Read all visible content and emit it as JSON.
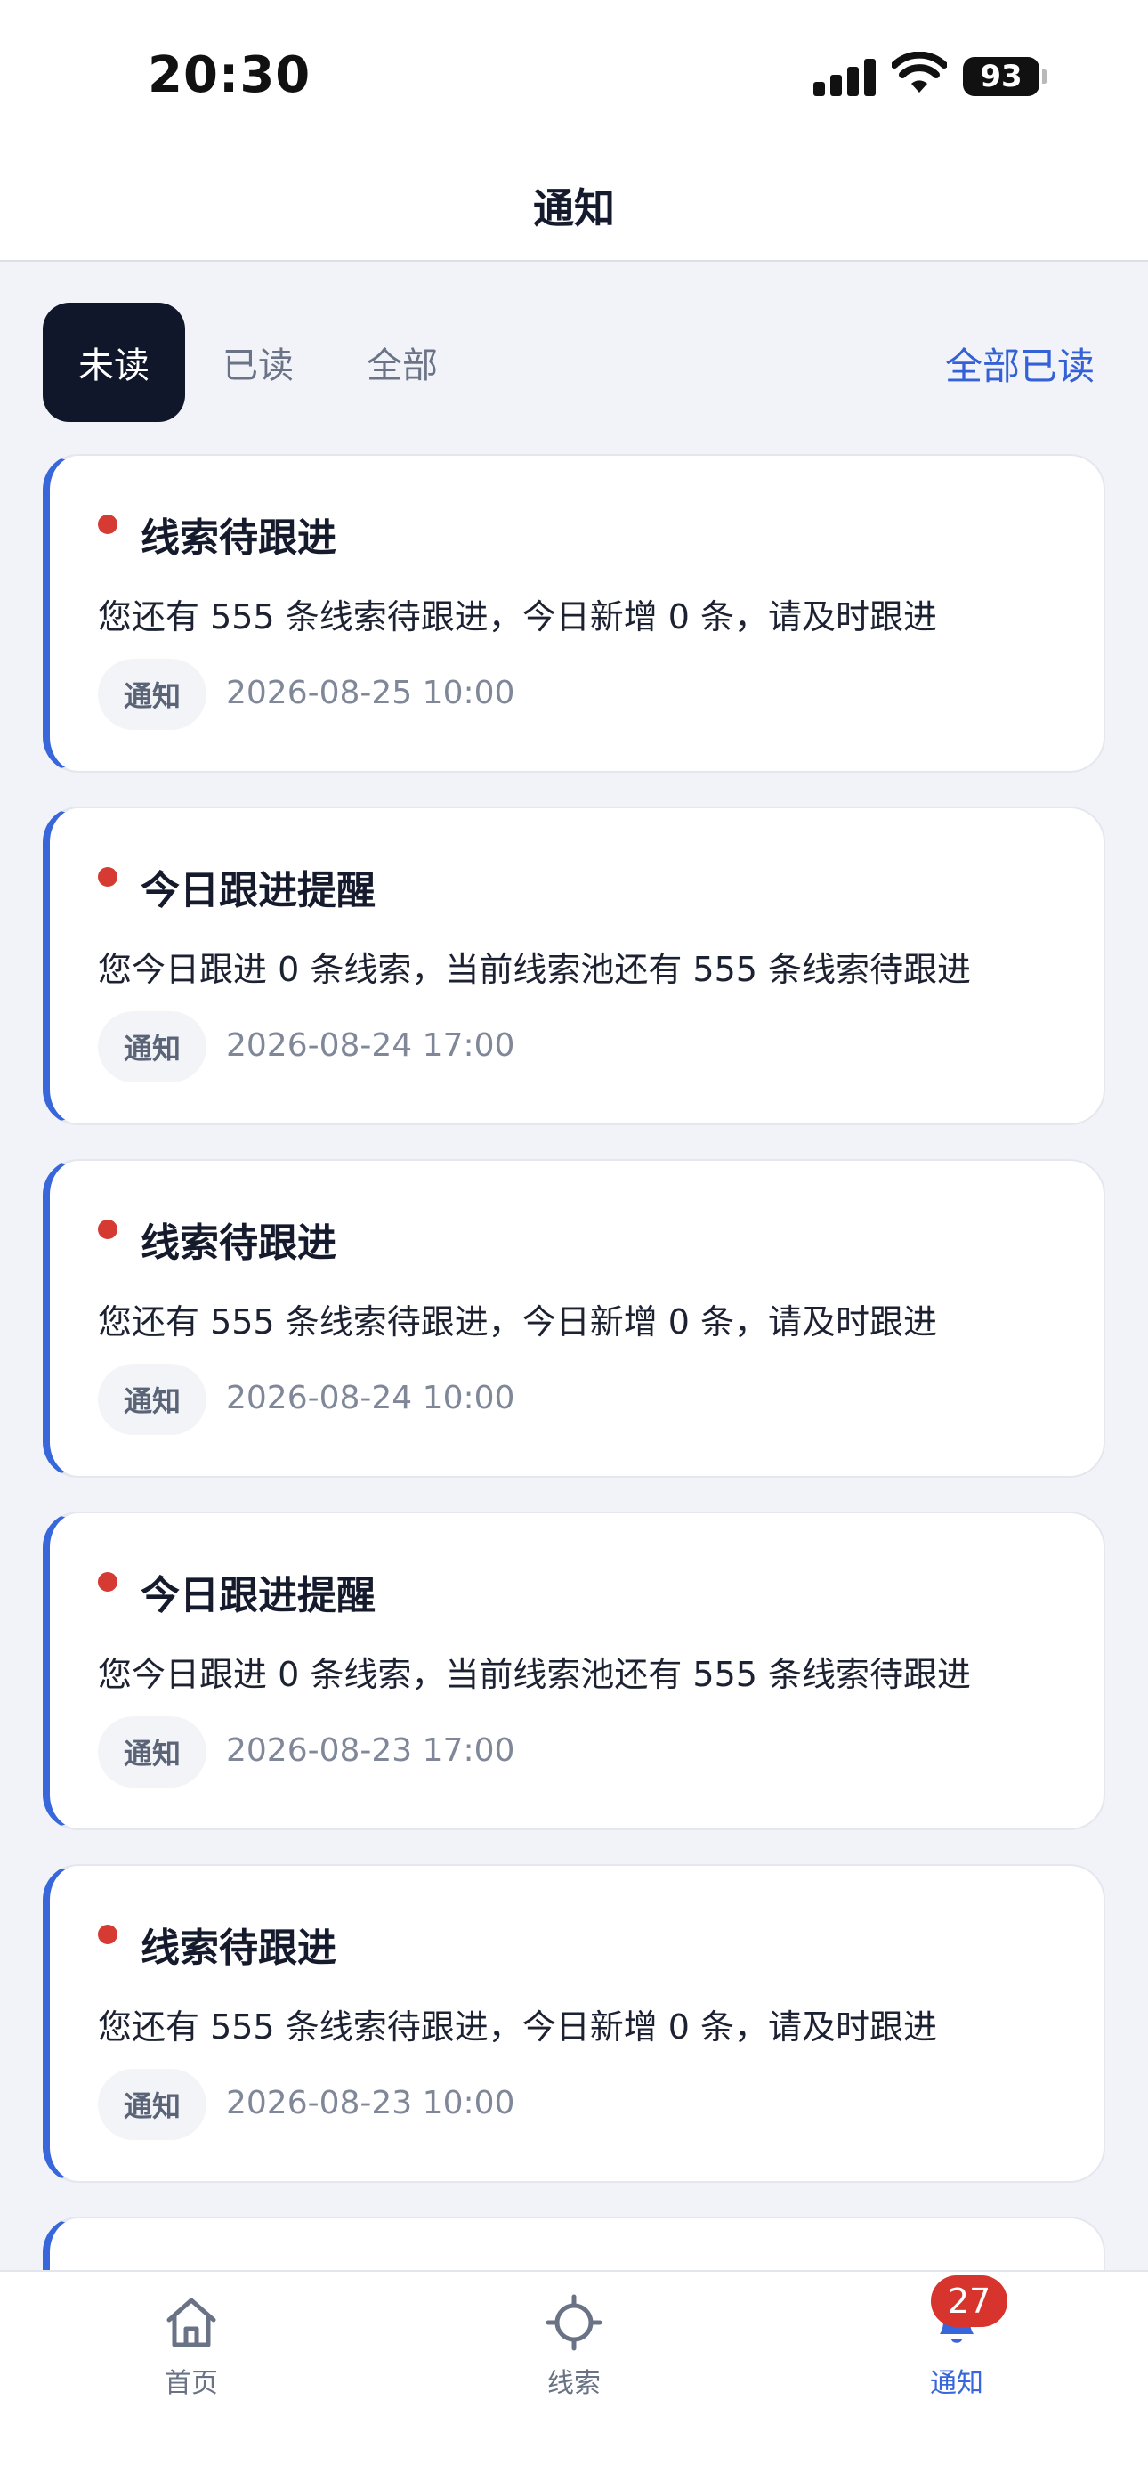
{
  "status_bar": {
    "time": "20:30",
    "battery": "93"
  },
  "header": {
    "title": "通知"
  },
  "tabs": [
    {
      "label": "未读",
      "active": true
    },
    {
      "label": "已读",
      "active": false
    },
    {
      "label": "全部",
      "active": false
    }
  ],
  "mark_all_read": "全部已读",
  "notifications": [
    {
      "title": "线索待跟进",
      "body": "您还有 555 条线索待跟进，今日新增 0 条，请及时跟进",
      "tag": "通知",
      "time": "2026-08-25 10:00",
      "unread": true
    },
    {
      "title": "今日跟进提醒",
      "body": "您今日跟进 0 条线索，当前线索池还有 555 条线索待跟进",
      "tag": "通知",
      "time": "2026-08-24 17:00",
      "unread": true
    },
    {
      "title": "线索待跟进",
      "body": "您还有 555 条线索待跟进，今日新增 0 条，请及时跟进",
      "tag": "通知",
      "time": "2026-08-24 10:00",
      "unread": true
    },
    {
      "title": "今日跟进提醒",
      "body": "您今日跟进 0 条线索，当前线索池还有 555 条线索待跟进",
      "tag": "通知",
      "time": "2026-08-23 17:00",
      "unread": true
    },
    {
      "title": "线索待跟进",
      "body": "您还有 555 条线索待跟进，今日新增 0 条，请及时跟进",
      "tag": "通知",
      "time": "2026-08-23 10:00",
      "unread": true
    }
  ],
  "tab_bar": {
    "items": [
      {
        "label": "首页",
        "icon": "home-icon"
      },
      {
        "label": "线索",
        "icon": "crosshair-icon"
      },
      {
        "label": "通知",
        "icon": "bell-icon"
      }
    ],
    "badge": "27"
  },
  "colors": {
    "accent": "#3866db",
    "unread_dot": "#d63b33",
    "active_tab": "#10172a"
  }
}
